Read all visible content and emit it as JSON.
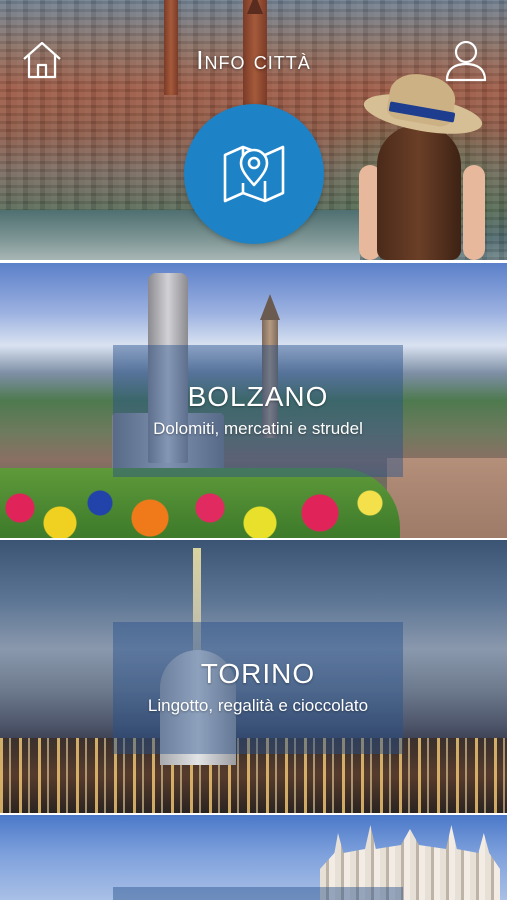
{
  "header": {
    "title": "Info città",
    "home_icon": "home-icon",
    "user_icon": "user-icon",
    "map_icon": "map-pin-icon",
    "accent_color": "#1e82c6"
  },
  "cities": [
    {
      "name": "BOLZANO",
      "tagline": "Dolomiti, mercatini e strudel"
    },
    {
      "name": "TORINO",
      "tagline": "Lingotto, regalità e cioccolato"
    },
    {
      "name": "",
      "tagline": ""
    }
  ]
}
